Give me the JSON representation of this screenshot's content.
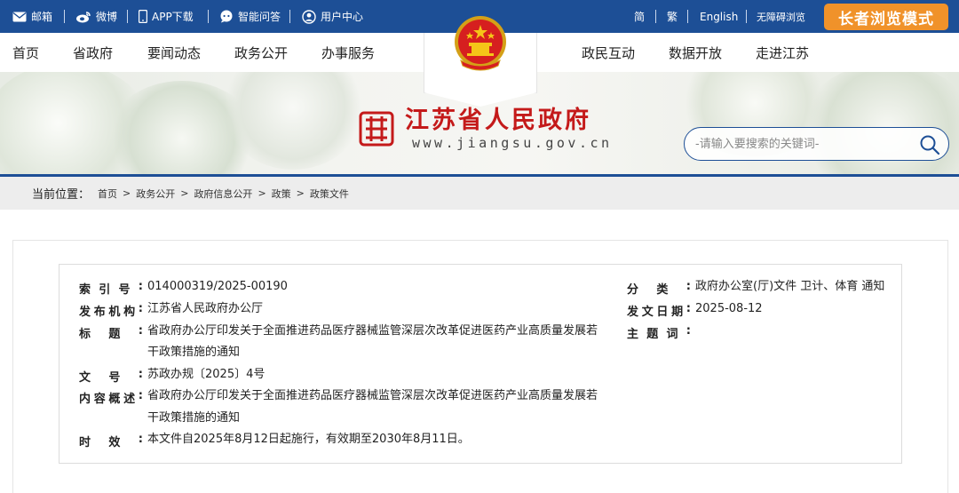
{
  "topbar": {
    "mail": "邮箱",
    "weibo": "微博",
    "app": "APP下载",
    "qa": "智能问答",
    "user_center": "用户中心",
    "simplified": "简",
    "traditional": "繁",
    "english": "English",
    "accessible": "无障碍浏览",
    "elder_mode": "长者浏览模式",
    "bar_color": "#1d4f96",
    "elder_color": "#f0922a"
  },
  "nav": {
    "home": "首页",
    "province_gov": "省政府",
    "news": "要闻动态",
    "open_affairs": "政务公开",
    "services": "办事服务",
    "interaction": "政民互动",
    "open_data": "数据开放",
    "about": "走进江苏"
  },
  "site": {
    "name": "江苏省人民政府",
    "url": "www.jiangsu.gov.cn",
    "brand_red": "#c41a1a"
  },
  "search": {
    "placeholder": "-请输入要搜索的关键词-"
  },
  "breadcrumb": {
    "label": "当前位置：",
    "items": [
      "首页",
      "政务公开",
      "政府信息公开",
      "政策",
      "政策文件"
    ]
  },
  "doc": {
    "index_label": [
      "索",
      "引",
      "号",
      ":"
    ],
    "index_value": "014000319/2025-00190",
    "publisher_label": [
      "发",
      "布",
      "机",
      "构",
      ":"
    ],
    "publisher_value": "江苏省人民政府办公厅",
    "title_label": [
      "标",
      "题",
      ":"
    ],
    "title_line1": "省政府办公厅印发关于全面推进药品医疗器械监管深层次改革促进医药产业高质量发展若",
    "title_line2": "干政策措施的通知",
    "docno_label": [
      "文",
      "号",
      ":"
    ],
    "docno_value": "苏政办规〔2025〕4号",
    "summary_label": [
      "内",
      "容",
      "概",
      "述",
      ":"
    ],
    "summary_line1": "省政府办公厅印发关于全面推进药品医疗器械监管深层次改革促进医药产业高质量发展若",
    "summary_line2": "干政策措施的通知",
    "effect_label": [
      "时",
      "效",
      ":"
    ],
    "effect_value": "本文件自2025年8月12日起施行，有效期至2030年8月11日。",
    "category_label": [
      "分",
      "类",
      ":"
    ],
    "category_value": "政府办公室(厅)文件 卫计、体育 通知",
    "date_label": [
      "发",
      "文",
      "日",
      "期",
      ":"
    ],
    "date_value": "2025-08-12",
    "subject_label": [
      "主",
      "题",
      "词",
      ":"
    ]
  }
}
